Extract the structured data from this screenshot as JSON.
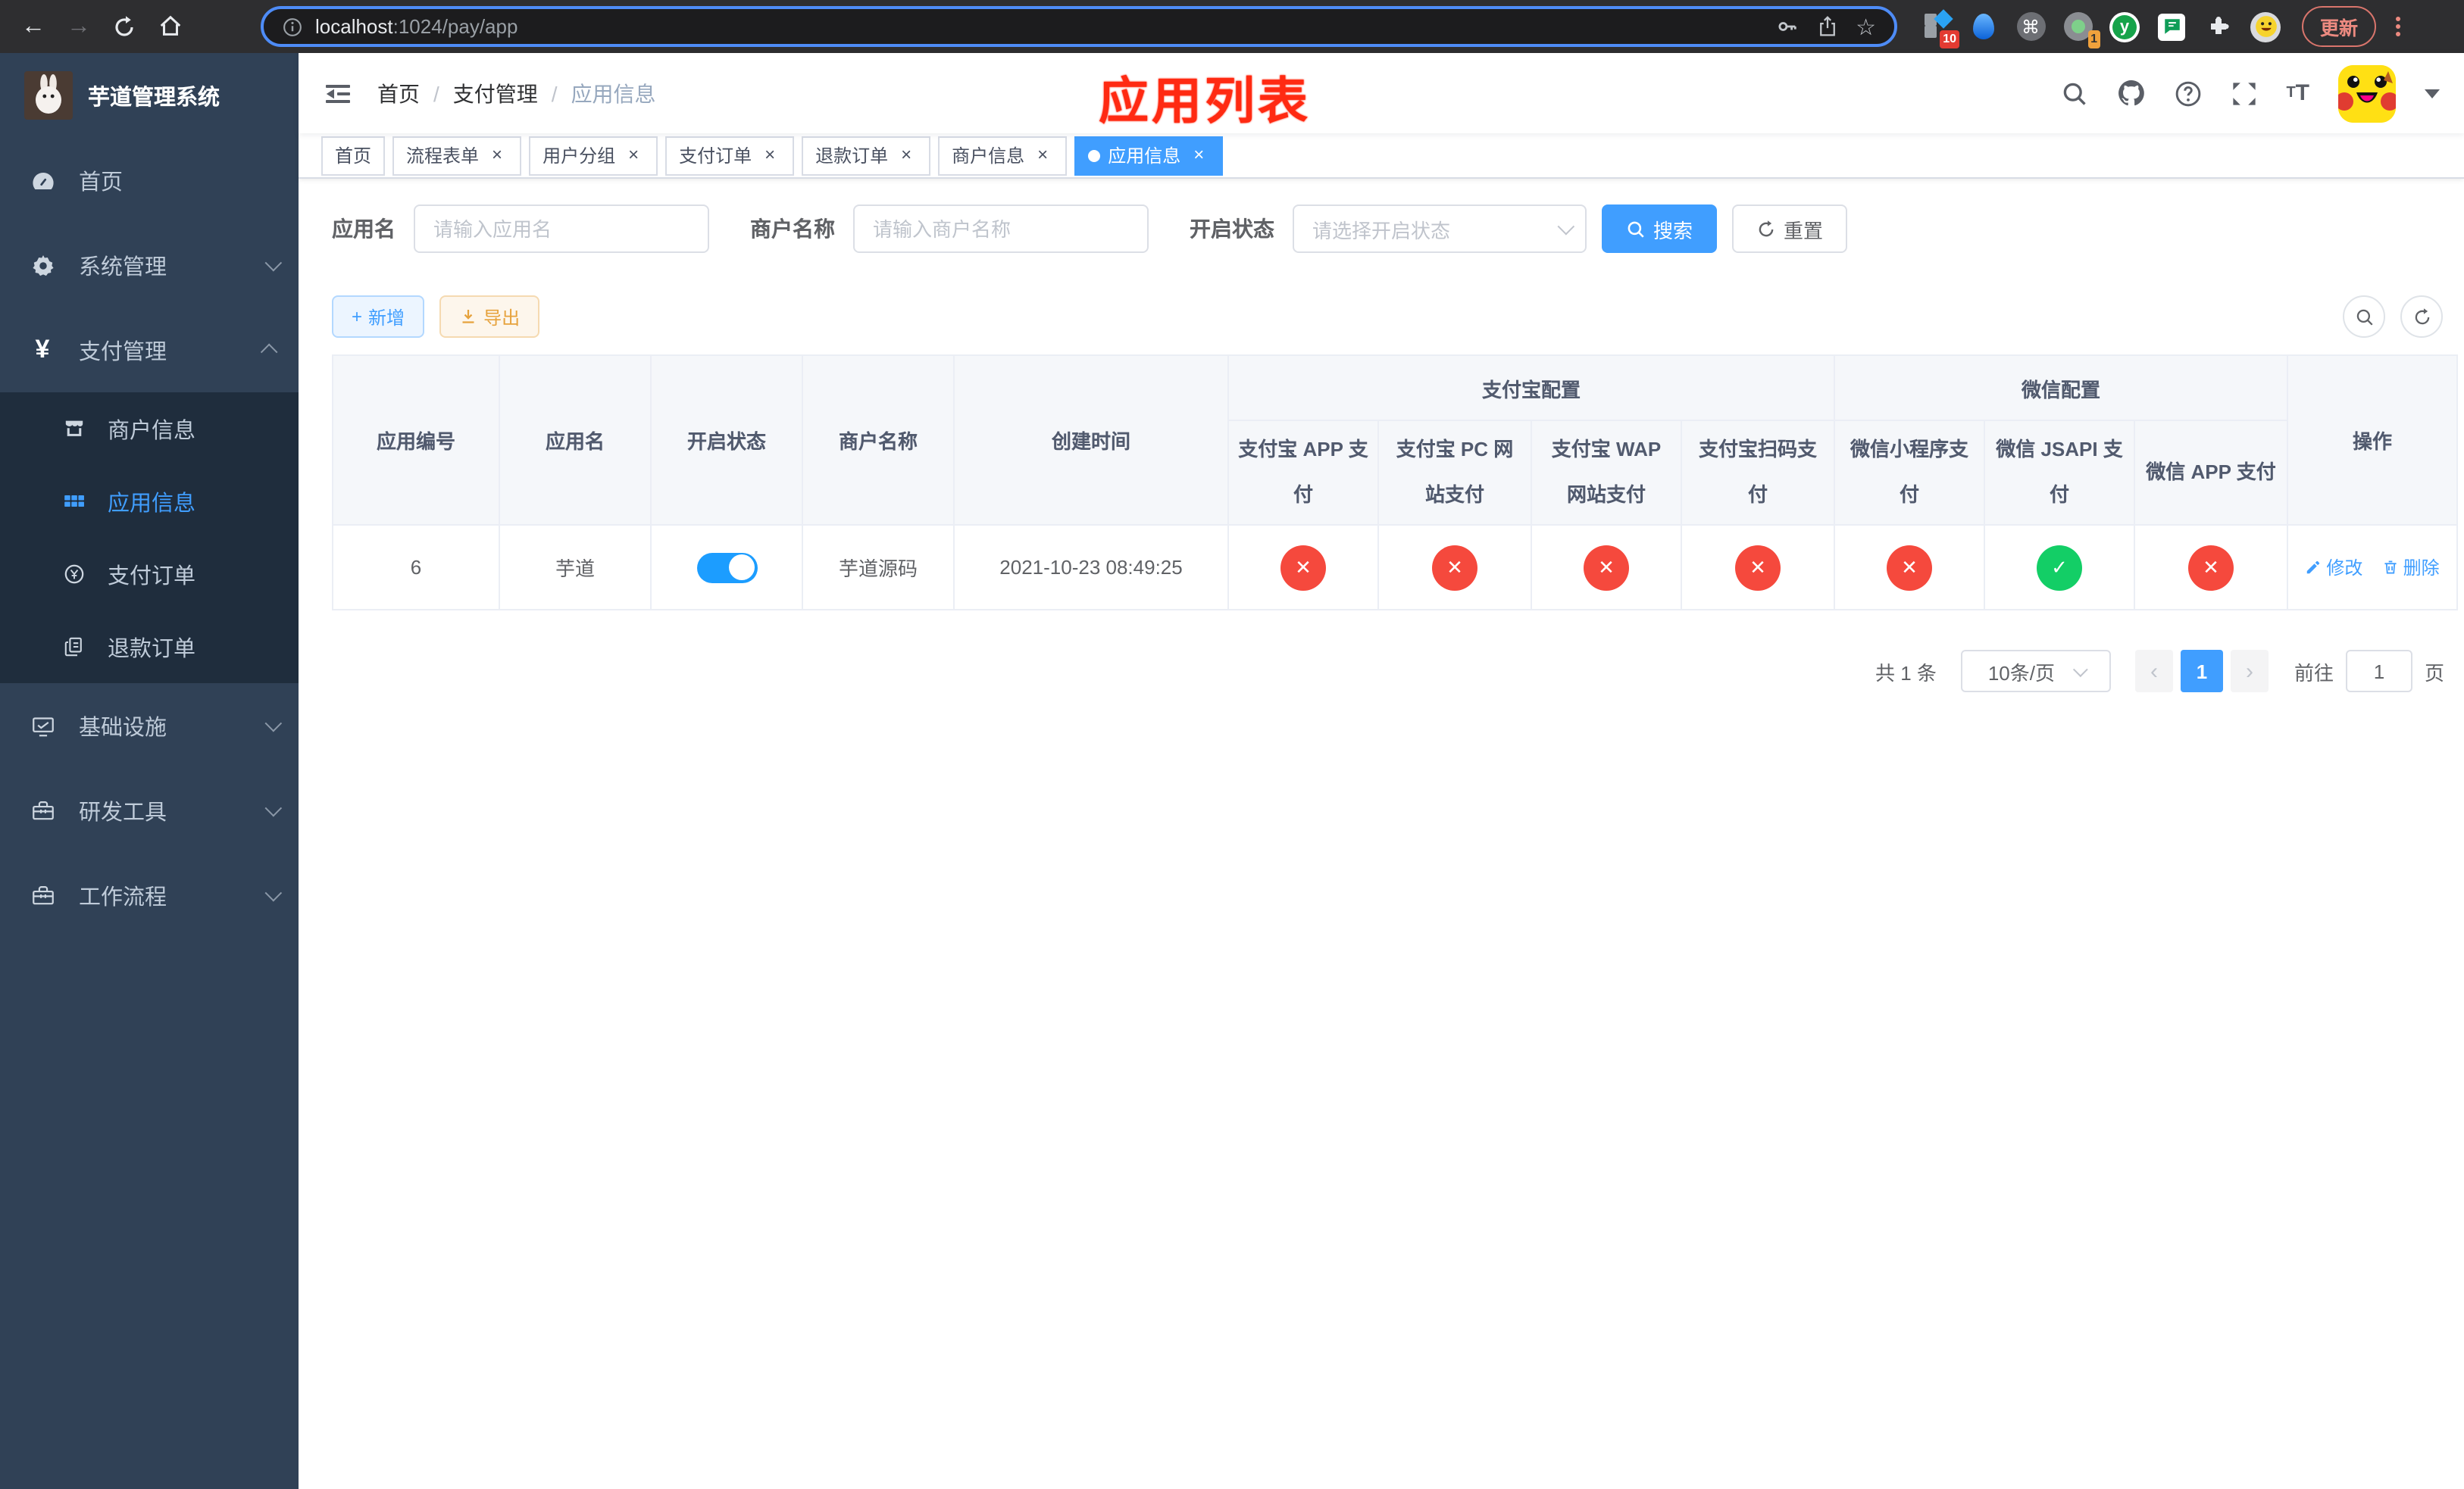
{
  "browser": {
    "url_host": "localhost",
    "url_rest": ":1024/pay/app",
    "update_button": "更新",
    "ext_badge_grid": "10",
    "ext_badge_rec": "1",
    "ext_y_letter": "y"
  },
  "sidebar": {
    "title": "芋道管理系统",
    "items": [
      {
        "label": "首页"
      },
      {
        "label": "系统管理"
      },
      {
        "label": "支付管理",
        "children": [
          {
            "label": "商户信息"
          },
          {
            "label": "应用信息",
            "active": true
          },
          {
            "label": "支付订单"
          },
          {
            "label": "退款订单"
          }
        ]
      },
      {
        "label": "基础设施"
      },
      {
        "label": "研发工具"
      },
      {
        "label": "工作流程"
      }
    ]
  },
  "navbar": {
    "breadcrumb": [
      "首页",
      "支付管理",
      "应用信息"
    ],
    "separator": "/",
    "annotation": "应用列表"
  },
  "tags": [
    {
      "label": "首页",
      "closable": false,
      "active": false
    },
    {
      "label": "流程表单",
      "closable": true,
      "active": false
    },
    {
      "label": "用户分组",
      "closable": true,
      "active": false
    },
    {
      "label": "支付订单",
      "closable": true,
      "active": false
    },
    {
      "label": "退款订单",
      "closable": true,
      "active": false
    },
    {
      "label": "商户信息",
      "closable": true,
      "active": false
    },
    {
      "label": "应用信息",
      "closable": true,
      "active": true
    }
  ],
  "search": {
    "app_name_label": "应用名",
    "app_name_placeholder": "请输入应用名",
    "merchant_name_label": "商户名称",
    "merchant_name_placeholder": "请输入商户名称",
    "status_label": "开启状态",
    "status_placeholder": "请选择开启状态",
    "search_button": "搜索",
    "reset_button": "重置"
  },
  "toolbar": {
    "add_button": "新增",
    "export_button": "导出"
  },
  "table": {
    "columns": [
      "应用编号",
      "应用名",
      "开启状态",
      "商户名称",
      "创建时间"
    ],
    "groups": [
      {
        "label": "支付宝配置",
        "sub": [
          "支付宝 APP 支付",
          "支付宝 PC 网站支付",
          "支付宝 WAP 网站支付",
          "支付宝扫码支付"
        ]
      },
      {
        "label": "微信配置",
        "sub": [
          "微信小程序支付",
          "微信 JSAPI 支付",
          "微信 APP 支付"
        ]
      }
    ],
    "actions_column": "操作",
    "row": {
      "id": "6",
      "name": "芋道",
      "enabled": true,
      "merchant": "芋道源码",
      "created_at": "2021-10-23 08:49:25",
      "pay_configs": [
        {
          "name": "alipay-app",
          "enabled": false
        },
        {
          "name": "alipay-pc",
          "enabled": false
        },
        {
          "name": "alipay-wap",
          "enabled": false
        },
        {
          "name": "alipay-qrcode",
          "enabled": false
        },
        {
          "name": "wechat-mini",
          "enabled": false
        },
        {
          "name": "wechat-jsapi",
          "enabled": true
        },
        {
          "name": "wechat-app",
          "enabled": false
        }
      ],
      "edit_label": "修改",
      "delete_label": "删除"
    }
  },
  "pagination": {
    "total": "共 1 条",
    "page_size": "10条/页",
    "current_page": "1",
    "goto_label": "前往",
    "goto_value": "1",
    "page_unit": "页"
  },
  "colors": {
    "primary": "#409EFF",
    "success": "#13ce66",
    "danger": "#f5493d",
    "warning": "#e6a23c"
  },
  "icons": {
    "check": "✓",
    "cross": "✕",
    "close": "×",
    "yen": "¥",
    "plus": "+",
    "back": "←",
    "forward": "→",
    "star": "☆",
    "command": "⌘",
    "question": "?",
    "prev": "‹",
    "next": "›",
    "font_small": "T",
    "font_large": "T"
  }
}
